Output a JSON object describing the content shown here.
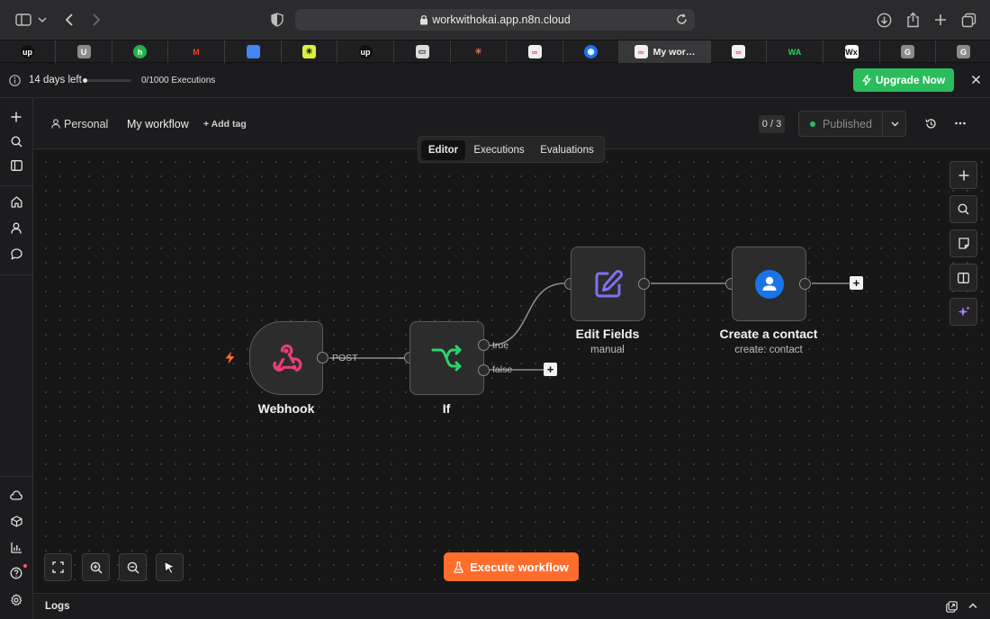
{
  "browser": {
    "url": "workwithokai.app.n8n.cloud",
    "tabs": [
      {
        "icon": "upwork-icon",
        "text": "up",
        "color": "#ffffff",
        "bg": "#111111",
        "round": true
      },
      {
        "icon": "u-icon",
        "text": "U",
        "color": "#ffffff",
        "bg": "#8a8a8a"
      },
      {
        "icon": "green-h-icon",
        "text": "h",
        "color": "#ffffff",
        "bg": "#22b24c",
        "round": true
      },
      {
        "icon": "gmail-icon",
        "text": "M",
        "color": "#ea4335",
        "bg": "transparent"
      },
      {
        "icon": "google-docs-icon",
        "text": "",
        "color": "#ffffff",
        "bg": "#4285f4"
      },
      {
        "icon": "lime-star-icon",
        "text": "✳",
        "color": "#111111",
        "bg": "#d8f13a"
      },
      {
        "icon": "upwork-icon",
        "text": "up",
        "color": "#ffffff",
        "bg": "#111111",
        "round": true
      },
      {
        "icon": "gray-site-icon",
        "text": "▭",
        "color": "#333333",
        "bg": "#dcdcdc"
      },
      {
        "icon": "claude-icon",
        "text": "✳",
        "color": "#d97757",
        "bg": "transparent"
      },
      {
        "icon": "n8n-icon",
        "text": "∞",
        "color": "#ea4b71",
        "bg": "#f0f0f0"
      },
      {
        "icon": "blue-circle-icon",
        "text": "◉",
        "color": "#ffffff",
        "bg": "#1a73e8",
        "round": true
      },
      {
        "icon": "n8n-icon",
        "text": "∞",
        "color": "#ea4b71",
        "bg": "#f0f0f0",
        "label": "My wor…",
        "active": true
      },
      {
        "icon": "n8n-icon",
        "text": "∞",
        "color": "#ea4b71",
        "bg": "#f0f0f0"
      },
      {
        "icon": "wa-icon",
        "text": "WA",
        "color": "#25d366",
        "bg": "transparent"
      },
      {
        "icon": "wix-icon",
        "text": "Wx",
        "color": "#111111",
        "bg": "#ffffff"
      },
      {
        "icon": "g-icon",
        "text": "G",
        "color": "#ffffff",
        "bg": "#8a8a8a"
      },
      {
        "icon": "g-icon",
        "text": "G",
        "color": "#ffffff",
        "bg": "#8a8a8a"
      }
    ]
  },
  "banner": {
    "days_left": "14 days left",
    "executions": "0/1000 Executions",
    "executions_progress": 0,
    "upgrade_label": "Upgrade Now"
  },
  "header": {
    "project": "Personal",
    "workflow_name": "My workflow",
    "add_tag": "+ Add tag",
    "counter": "0 / 3",
    "published": "Published"
  },
  "view_tabs": [
    "Editor",
    "Executions",
    "Evaluations"
  ],
  "nodes": {
    "webhook": {
      "title": "Webhook",
      "edge_label": "POST"
    },
    "if": {
      "title": "If",
      "true_label": "true",
      "false_label": "false"
    },
    "edit_fields": {
      "title": "Edit Fields",
      "subtitle": "manual"
    },
    "create_contact": {
      "title": "Create a contact",
      "subtitle": "create: contact"
    }
  },
  "execute_label": "Execute workflow",
  "logs_label": "Logs",
  "colors": {
    "accent_orange": "#ff6d2d",
    "upgrade_green": "#2bbd5c",
    "webhook_pink": "#e83e7a",
    "if_green": "#2bd46b",
    "edit_purple": "#7d72f5",
    "contact_blue": "#1a73e8"
  }
}
